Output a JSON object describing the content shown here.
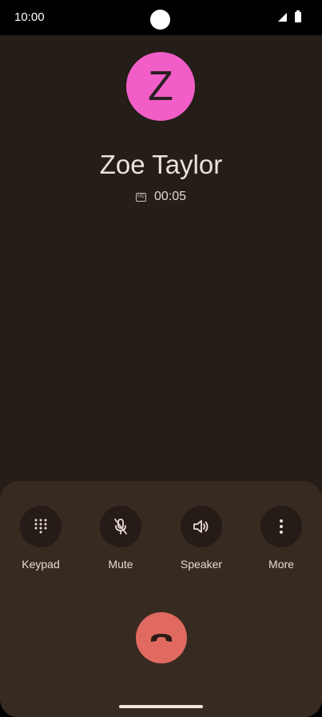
{
  "status_bar": {
    "time": "10:00"
  },
  "contact": {
    "initial": "Z",
    "name": "Zoe Taylor",
    "avatar_color": "#f25ec7"
  },
  "call": {
    "quality_badge": "HD",
    "duration": "00:05"
  },
  "controls": [
    {
      "label": "Keypad",
      "icon": "dialpad-icon"
    },
    {
      "label": "Mute",
      "icon": "mic-off-icon"
    },
    {
      "label": "Speaker",
      "icon": "volume-icon"
    },
    {
      "label": "More",
      "icon": "more-vert-icon"
    }
  ],
  "end_call": {
    "icon": "call-end-icon",
    "color": "#e06a60"
  }
}
